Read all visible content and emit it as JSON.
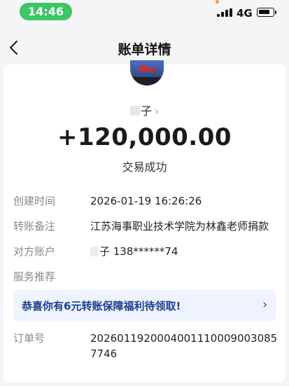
{
  "status_bar": {
    "time": "14:46",
    "network": "4G"
  },
  "nav": {
    "title": "账单详情"
  },
  "counterparty": {
    "name_visible": "子",
    "chevron": "›"
  },
  "transaction": {
    "amount": "+120,000.00",
    "status": "交易成功"
  },
  "details": [
    {
      "label": "创建时间",
      "value": "2026-01-19 16:26:26"
    },
    {
      "label": "转账备注",
      "value": "江苏海事职业技术学院为林鑫老师捐款"
    },
    {
      "label": "对方账户",
      "value": "子 138******74"
    },
    {
      "label": "服务推荐",
      "value": ""
    }
  ],
  "promo": {
    "text": "恭喜你有6元转账保障福利待领取!",
    "arrow": "›"
  },
  "order": {
    "label": "订单号",
    "value": "20260119200040011100090030857746"
  },
  "icons": [
    "back-icon",
    "signal-icon",
    "battery-icon",
    "chevron-right-icon"
  ],
  "colors": {
    "time_pill": "#3cc764",
    "promo_bg": "#eef3ff",
    "promo_text": "#1a3f8f"
  }
}
